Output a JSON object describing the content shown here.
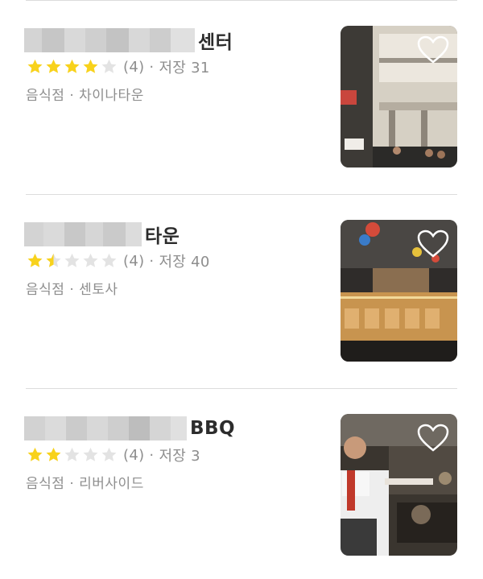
{
  "listings": [
    {
      "title_suffix": "센터",
      "rating_count": "(4)",
      "separator": "·",
      "saves": "저장 31",
      "category": "음식점",
      "location": "차이나타운",
      "rating": 4,
      "photo_icon": "heart-icon"
    },
    {
      "title_suffix": "타운",
      "rating_count": "(4)",
      "separator": "·",
      "saves": "저장 40",
      "category": "음식점",
      "location": "센토사",
      "rating": 1.5,
      "photo_icon": "heart-icon"
    },
    {
      "title_suffix": "BBQ",
      "rating_count": "(4)",
      "separator": "·",
      "saves": "저장 3",
      "category": "음식점",
      "location": "리버사이드",
      "rating": 2,
      "photo_icon": "heart-icon"
    }
  ],
  "colors": {
    "star_on": "#f8d21c",
    "star_off": "#e3e3e3",
    "meta": "#8e8e8e"
  }
}
